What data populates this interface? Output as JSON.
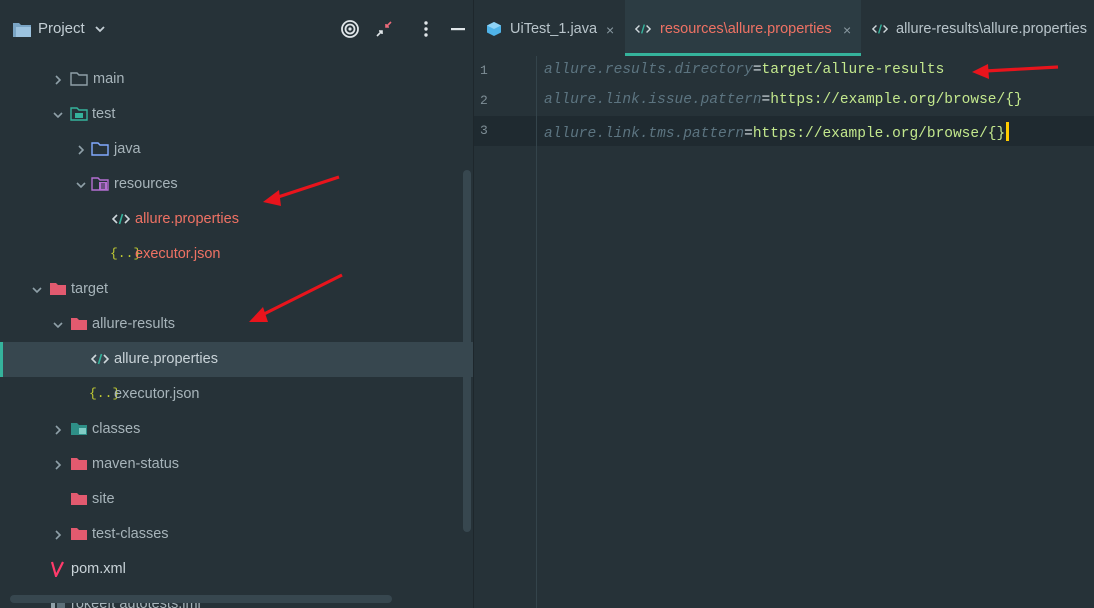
{
  "project_panel": {
    "title": "Project",
    "toolbar": {
      "locate_icon": "target-icon",
      "collapse_icon": "collapse-icon",
      "options_icon": "more-vertical-icon",
      "hide_icon": "minimize-icon"
    },
    "tree": [
      {
        "label": "main",
        "icon": "folder-icon",
        "color": "#a7b4ba",
        "expanded": false
      },
      {
        "label": "test",
        "icon": "test-folder-icon",
        "color": "#a7b4ba",
        "expanded": true
      },
      {
        "label": "java",
        "icon": "source-folder-icon",
        "color": "#a7b4ba",
        "expanded": false
      },
      {
        "label": "resources",
        "icon": "resources-folder-icon",
        "color": "#a7b4ba",
        "expanded": true
      },
      {
        "label": "allure.properties",
        "icon": "properties-file-icon",
        "color": "#ef7264"
      },
      {
        "label": "executor.json",
        "icon": "json-file-icon",
        "color": "#ef7264"
      },
      {
        "label": "target",
        "icon": "excluded-folder-icon",
        "color": "#a7b4ba",
        "expanded": true
      },
      {
        "label": "allure-results",
        "icon": "excluded-folder-icon",
        "color": "#a7b4ba",
        "expanded": true
      },
      {
        "label": "allure.properties",
        "icon": "properties-file-icon",
        "color": "#c9d3d8",
        "selected": true
      },
      {
        "label": "executor.json",
        "icon": "json-file-icon",
        "color": "#a7b4ba"
      },
      {
        "label": "classes",
        "icon": "excluded-folder-icon",
        "color": "#a7b4ba",
        "expanded": false
      },
      {
        "label": "maven-status",
        "icon": "excluded-folder-icon",
        "color": "#a7b4ba",
        "expanded": false
      },
      {
        "label": "site",
        "icon": "excluded-folder-icon",
        "color": "#a7b4ba"
      },
      {
        "label": "test-classes",
        "icon": "excluded-folder-icon",
        "color": "#a7b4ba",
        "expanded": false
      },
      {
        "label": "pom.xml",
        "icon": "maven-icon",
        "color": "#c9d3d8"
      },
      {
        "label": "rokeeft autotests.iml",
        "icon": "module-file-icon",
        "color": "#a7b4ba"
      }
    ]
  },
  "editor": {
    "tabs": [
      {
        "label": "UiTest_1.java",
        "icon": "java-class-icon",
        "active": false,
        "closable": true
      },
      {
        "label": "resources\\allure.properties",
        "icon": "properties-file-icon",
        "active": true,
        "closable": true
      },
      {
        "label": "allure-results\\allure.properties",
        "icon": "properties-file-icon",
        "active": false,
        "closable": false
      }
    ],
    "close_glyph": "×",
    "lines": [
      {
        "number": "1",
        "key": "allure.results.directory",
        "sep": "=",
        "value": "target/allure-results"
      },
      {
        "number": "2",
        "key": "allure.link.issue.pattern",
        "sep": "=",
        "value": "https://example.org/browse/{}"
      },
      {
        "number": "3",
        "key": "allure.link.tms.pattern",
        "sep": "=",
        "value": "https://example.org/browse/{}",
        "current": true
      }
    ]
  },
  "colors": {
    "background": "#263238",
    "accent": "#35b39c",
    "modified_file": "#ef7264",
    "annotation_arrow": "#e8141c",
    "caret": "#ffcc00"
  }
}
